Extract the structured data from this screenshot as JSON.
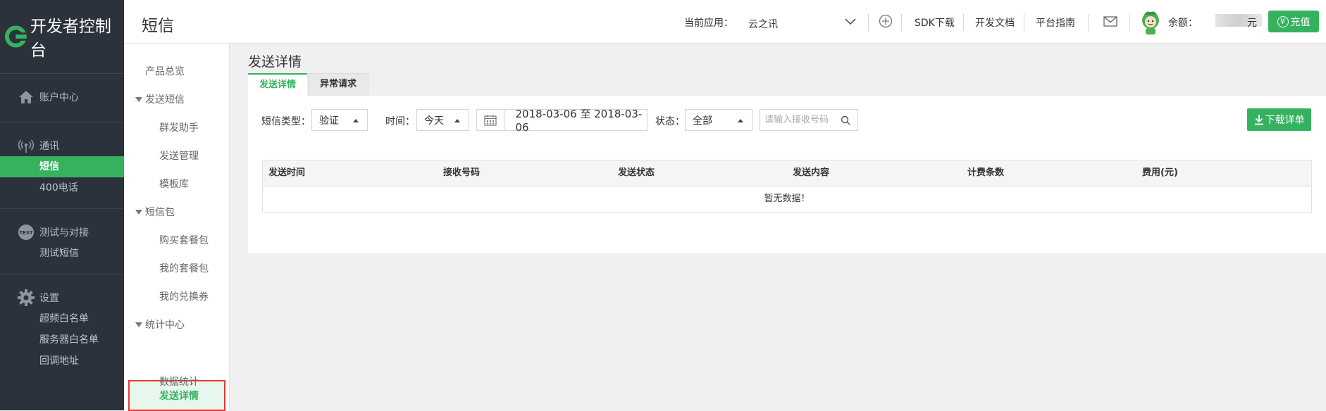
{
  "brand": {
    "title": "开发者控制台"
  },
  "leftnav": {
    "groups": [
      {
        "title": "账户中心",
        "icon": "home-icon",
        "items": []
      },
      {
        "title": "通讯",
        "icon": "signal-icon",
        "items": [
          {
            "label": "短信",
            "active": true
          },
          {
            "label": "400电话",
            "active": false
          }
        ]
      },
      {
        "title": "测试与对接",
        "icon": "test-icon",
        "items": [
          {
            "label": "测试短信",
            "active": false
          }
        ]
      },
      {
        "title": "设置",
        "icon": "gear-icon",
        "items": [
          {
            "label": "超频白名单"
          },
          {
            "label": "服务器白名单"
          },
          {
            "label": "回调地址"
          }
        ]
      }
    ]
  },
  "header": {
    "page_title": "短信",
    "current_app_label": "当前应用：",
    "current_app_value": "云之讯",
    "links": {
      "sdk": "SDK下载",
      "docs": "开发文档",
      "guide": "平台指南"
    },
    "balance_label": "余额：",
    "balance_unit": "元",
    "recharge_label": "充值",
    "recharge_symbol": "¥"
  },
  "submenu": {
    "overview": "产品总览",
    "send_sms": "发送短信",
    "send_items": [
      "群发助手",
      "发送管理",
      "模板库"
    ],
    "sms_pack": "短信包",
    "pack_items": [
      "购买套餐包",
      "我的套餐包",
      "我的兑换券"
    ],
    "stats_center": "统计中心",
    "stats_active": "发送详情",
    "stats_other": "数据统计"
  },
  "main": {
    "title": "发送详情",
    "tabs": [
      {
        "label": "发送详情",
        "active": true
      },
      {
        "label": "异常请求",
        "active": false
      }
    ],
    "filters": {
      "type_label": "短信类型：",
      "type_value": "验证",
      "time_label": "时间：",
      "time_value": "今天",
      "date_range": "2018-03-06 至 2018-03-06",
      "status_label": "状态：",
      "status_value": "全部",
      "phone_placeholder": "请输入接收号码"
    },
    "download_label": "下载详单",
    "table": {
      "columns": [
        "发送时间",
        "接收号码",
        "发送状态",
        "发送内容",
        "计费条数",
        "费用(元)"
      ],
      "empty_text": "暂无数据！"
    }
  }
}
